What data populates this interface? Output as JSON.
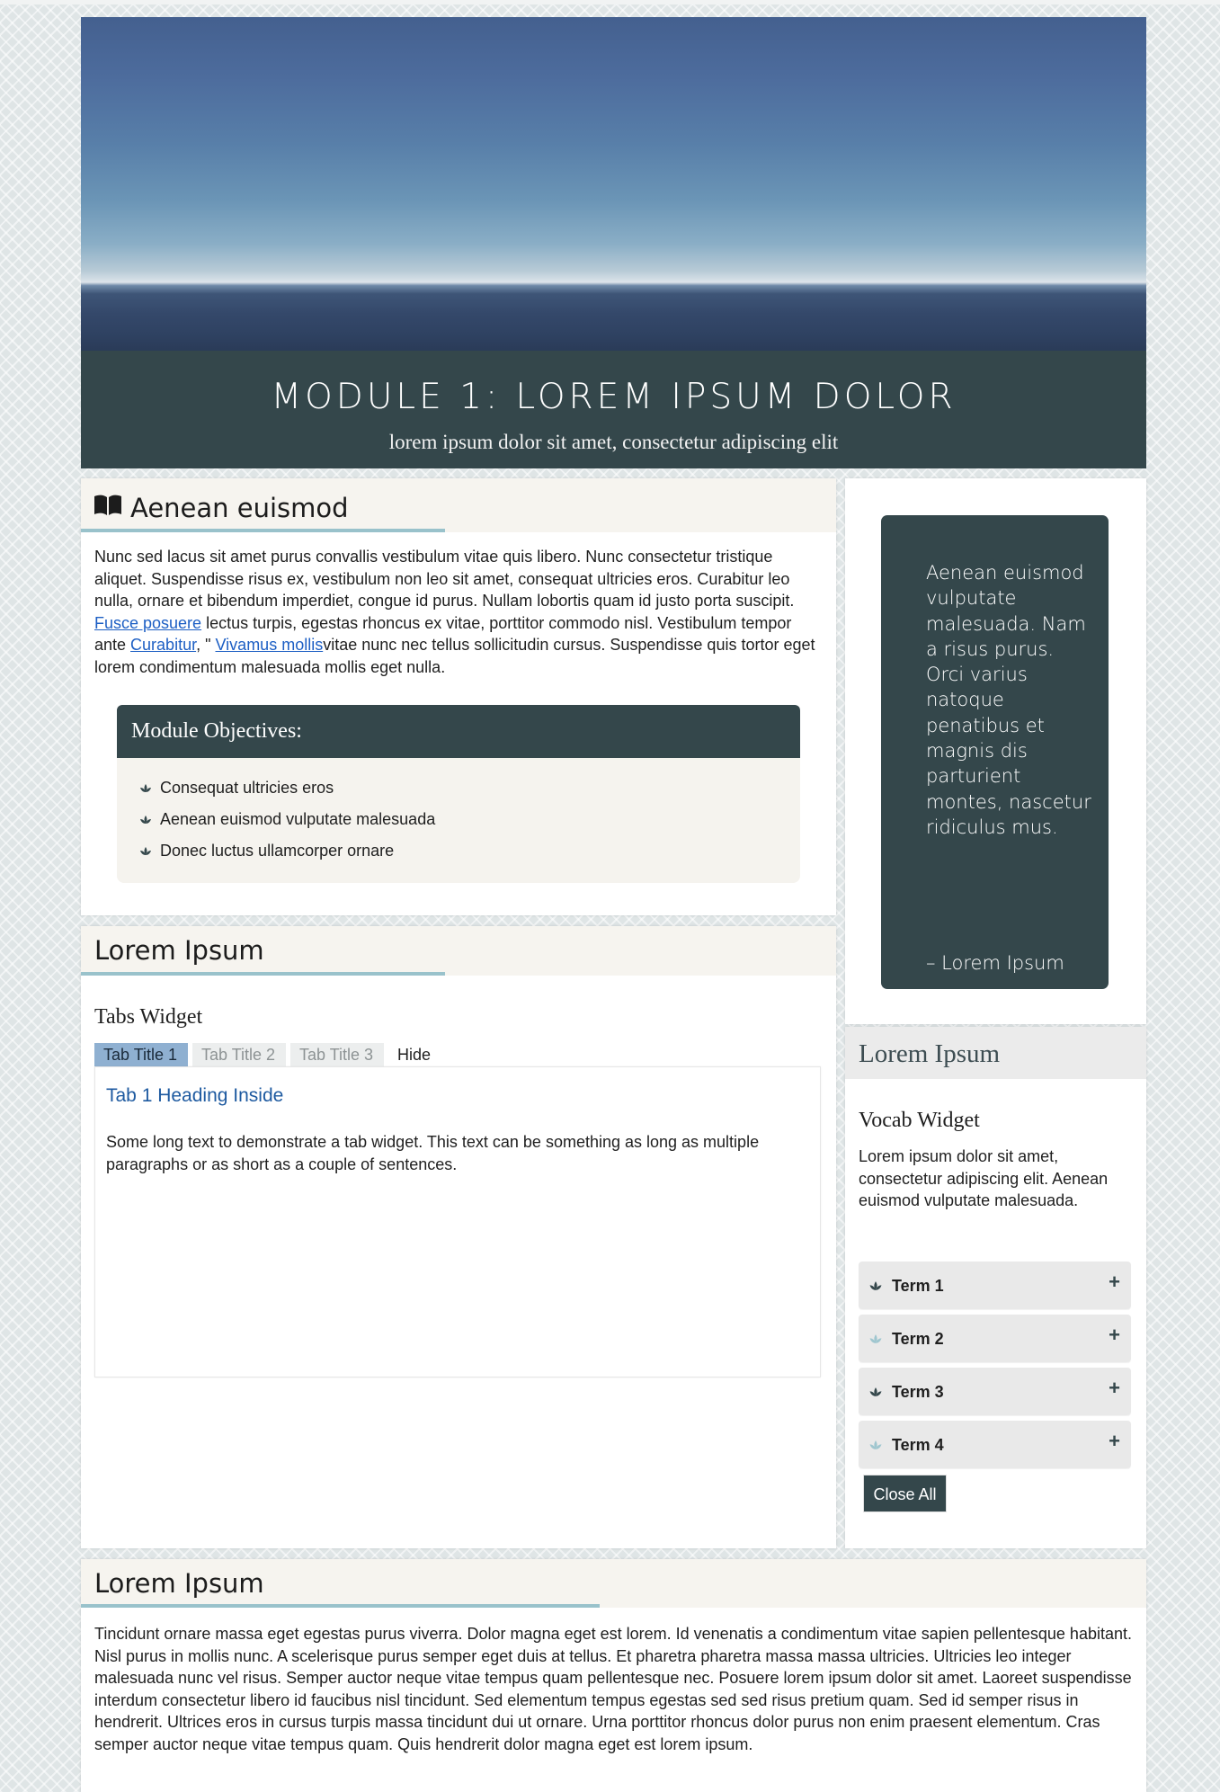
{
  "banner": {
    "title": "MODULE 1: LOREM IPSUM DOLOR",
    "subtitle": "lorem ipsum dolor sit amet, consectetur adipiscing elit"
  },
  "intro": {
    "heading": "Aenean euismod",
    "icon": "book-open-icon",
    "paragraph": {
      "text1": "Nunc sed lacus sit amet purus convallis vestibulum vitae quis libero. Nunc consectetur tristique aliquet. Suspendisse risus ex, vestibulum non leo sit amet, consequat ultricies eros. Curabitur leo nulla, ornare et bibendum imperdiet, congue id purus. Nullam lobortis quam id justo porta suscipit. ",
      "link1": "Fusce posuere",
      "text2": " lectus turpis, egestas rhoncus ex vitae, porttitor commodo nisl. Vestibulum tempor ante ",
      "link2": "Curabitur",
      "text3": ", \" ",
      "link3": "Vivamus mollis",
      "text4": "vitae nunc nec tellus sollicitudin cursus. Suspendisse quis tortor eget lorem condimentum malesuada mollis eget nulla."
    },
    "objectives": {
      "title": "Module Objectives:",
      "items": [
        "Consequat ultricies eros",
        "Aenean euismod vulputate malesuada",
        "Donec luctus ullamcorper ornare"
      ]
    }
  },
  "quote": {
    "text": "Aenean euismod vulputate malesuada. Nam a risus purus. Orci varius natoque penatibus et magnis dis parturient montes, nascetur ridiculus mus.",
    "attribution": "– Lorem Ipsum"
  },
  "tabs_section": {
    "heading": "Lorem Ipsum",
    "widget_title": "Tabs Widget",
    "tabs": [
      "Tab Title 1",
      "Tab Title 2",
      "Tab Title 3"
    ],
    "hide_label": "Hide",
    "active_heading": "Tab 1 Heading Inside",
    "active_text": "Some long text to demonstrate a tab widget. This text can be something as long as multiple paragraphs or as short as a couple of sentences."
  },
  "vocab_section": {
    "heading": "Lorem Ipsum",
    "widget_title": "Vocab Widget",
    "description": "Lorem ipsum dolor sit amet, consectetur adipiscing elit. Aenean euismod vulputate malesuada.",
    "terms": [
      "Term 1",
      "Term 2",
      "Term 3",
      "Term 4"
    ],
    "expand_symbol": "+",
    "close_all": "Close All"
  },
  "bottom": {
    "heading": "Lorem Ipsum",
    "paragraph": "Tincidunt ornare massa eget egestas purus viverra. Dolor magna eget est lorem. Id venenatis a condimentum vitae sapien pellentesque habitant. Nisl purus in mollis nunc. A scelerisque purus semper eget duis at tellus. Et pharetra pharetra massa massa ultricies. Ultricies leo integer malesuada nunc vel risus. Semper auctor neque vitae tempus quam pellentesque nec. Posuere lorem ipsum dolor sit amet. Laoreet suspendisse interdum consectetur libero id faucibus nisl tincidunt. Sed elementum tempus egestas sed sed risus pretium quam. Sed id semper risus in hendrerit. Ultrices eros in cursus turpis massa tincidunt dui ut ornare. Urna porttitor rhoncus dolor purus non enim praesent elementum. Cras semper auctor neque vitae tempus quam. Quis hendrerit dolor magna eget est lorem ipsum."
  },
  "colors": {
    "accent_dark": "#34474b",
    "underline": "#99c2cb",
    "link": "#1d5fc4",
    "active_tab": "#8fb0d1"
  }
}
